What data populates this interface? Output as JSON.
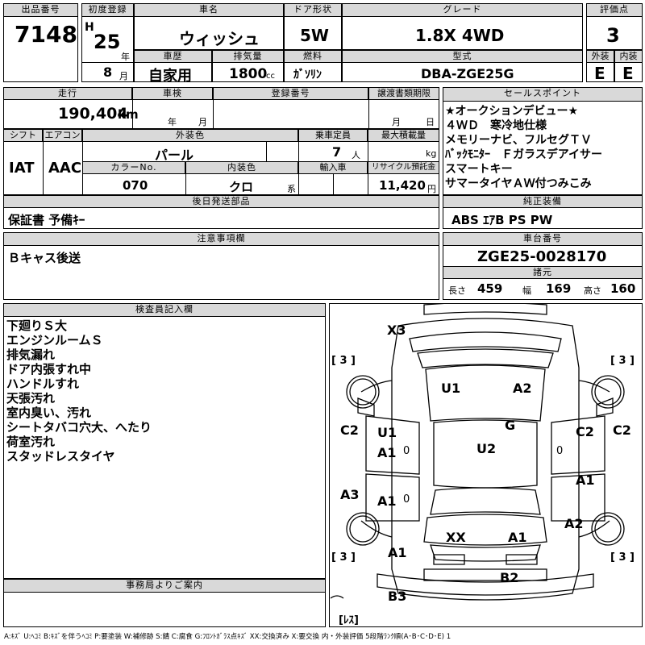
{
  "headers": {
    "lot_no": "出品番号",
    "first_reg": "初度登録",
    "car_name": "車名",
    "door_type": "ドア形状",
    "grade": "グレード",
    "score": "評価点",
    "ext": "外装",
    "int": "内装",
    "history": "車歴",
    "displacement": "排気量",
    "fuel": "燃料",
    "model_code": "型式",
    "mileage": "走行",
    "inspection": "車検",
    "reg_no": "登録番号",
    "transfer_deadline": "譲渡書類期限",
    "shift": "シフト",
    "aircon": "エアコン",
    "ext_color": "外装色",
    "capacity": "乗車定員",
    "max_load": "最大積載量",
    "color_no": "カラーNo.",
    "int_color": "内装色",
    "import": "輸入車",
    "recycle": "リサイクル預託金",
    "later_parts": "後日発送部品",
    "sales_points": "セールスポイント",
    "genuine_equip": "純正装備",
    "caution": "注意事項欄",
    "chassis_no": "車台番号",
    "specs": "諸元",
    "inspector": "検査員記入欄",
    "office": "事務局よりご案内"
  },
  "lot_no": "7148",
  "first_reg": {
    "era": "H",
    "year": "25",
    "year_unit": "年",
    "month": "8",
    "month_unit": "月"
  },
  "car_name": "ウィッシュ",
  "door_type": "5W",
  "grade": "1.8X 4WD",
  "score": "3",
  "ext_score": "E",
  "int_score": "E",
  "history": "自家用",
  "displacement": "1800",
  "displacement_unit": "cc",
  "fuel": "ｶﾞｿﾘﾝ",
  "model_code": "DBA-ZGE25G",
  "mileage": "190,404",
  "mileage_unit": "km",
  "inspection_year": "年",
  "inspection_month": "月",
  "transfer_month": "月",
  "transfer_day": "日",
  "shift": "IAT",
  "aircon": "AAC",
  "ext_color": "パール",
  "capacity": "7",
  "capacity_unit": "人",
  "max_load_unit": "kg",
  "color_no": "070",
  "int_color": "クロ",
  "int_color_suffix": "系",
  "recycle": "11,420",
  "recycle_unit": "円",
  "later_parts": "保証書 予備ｷｰ",
  "sales_points": [
    "★オークションデビュー★",
    "４ＷＤ　寒冷地仕様",
    "メモリーナビ、フルセグＴＶ",
    "ﾊﾞｯｸﾓﾆﾀｰ　Ｆガラスデアイサー",
    "スマートキー",
    "サマータイヤＡＷ付つみこみ"
  ],
  "genuine_equip": "ABS ｴｱB PS PW",
  "caution": "Ｂキャス後送",
  "chassis_no": "ZGE25-0028170",
  "specs": {
    "length_label": "長さ",
    "length": "459",
    "width_label": "幅",
    "width": "169",
    "height_label": "高さ",
    "height": "160"
  },
  "inspector_notes": [
    "下廻りＳ大",
    "エンジンルームＳ",
    "排気漏れ",
    "ドア内張すれ中",
    "ハンドルすれ",
    "天張汚れ",
    "室内臭い、汚れ",
    "シートタバコ穴大、へたり",
    "荷室汚れ",
    "スタッドレスタイヤ"
  ],
  "diagram": {
    "X3": "X3",
    "U1_roof": "U1",
    "A2_roof": "A2",
    "G": "G",
    "U1_left": "U1",
    "A1_left_mid": "A1",
    "U2": "U2",
    "C2_left": "C2",
    "C2_right_in": "C2",
    "C2_right": "C2",
    "A3": "A3",
    "A1_left_low": "A1",
    "A1_right": "A1",
    "A2_right": "A2",
    "XX": "XX",
    "A1_rear": "A1",
    "A1_bottom_left": "A1",
    "B2": "B2",
    "B3": "B3",
    "zero1": "0",
    "zero2": "0",
    "zero3": "0",
    "tire_fl": "[ 3 ]",
    "tire_fr": "[ 3 ]",
    "tire_rl": "[ 3 ]",
    "tire_rr": "[ 3 ]",
    "spare": "[ﾚｽ]"
  },
  "legend": "A:ｷｽﾞ U:ﾍｺﾐ B:ｷｽﾞを伴うﾍｺﾐ P:要塗装 W:補修跡 S:錆 C:腐食 G:ﾌﾛﾝﾄｶﾞﾗｽ点ｷｽﾞ XX:交換済み X:要交換 内・外装評価 5段階ﾗﾝｸ順(A･B･C･D･E) 1"
}
